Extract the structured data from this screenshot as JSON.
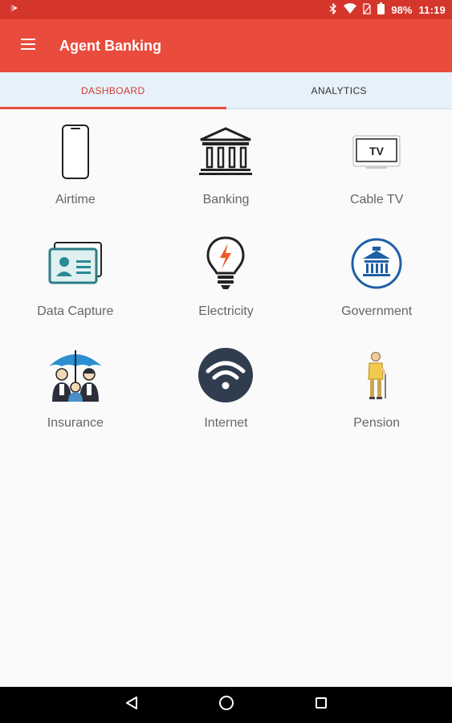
{
  "status_bar": {
    "battery": "98%",
    "time": "11:19"
  },
  "app_bar": {
    "title": "Agent Banking",
    "menu_icon": "hamburger-menu-icon"
  },
  "tabs": [
    {
      "label": "DASHBOARD",
      "active": true
    },
    {
      "label": "ANALYTICS",
      "active": false
    }
  ],
  "dashboard": {
    "items": [
      {
        "label": "Airtime",
        "icon": "mobile-phone-icon"
      },
      {
        "label": "Banking",
        "icon": "bank-building-icon"
      },
      {
        "label": "Cable TV",
        "icon": "tv-icon"
      },
      {
        "label": "Data Capture",
        "icon": "id-card-icon"
      },
      {
        "label": "Electricity",
        "icon": "light-bulb-icon"
      },
      {
        "label": "Government",
        "icon": "government-building-icon"
      },
      {
        "label": "Insurance",
        "icon": "family-umbrella-icon"
      },
      {
        "label": "Internet",
        "icon": "wifi-icon"
      },
      {
        "label": "Pension",
        "icon": "elderly-person-icon"
      }
    ]
  },
  "colors": {
    "primary": "#e94c3d",
    "status_bar": "#d4362b",
    "tab_bar": "#e6f1fa",
    "accent_text": "#d13b2f"
  }
}
